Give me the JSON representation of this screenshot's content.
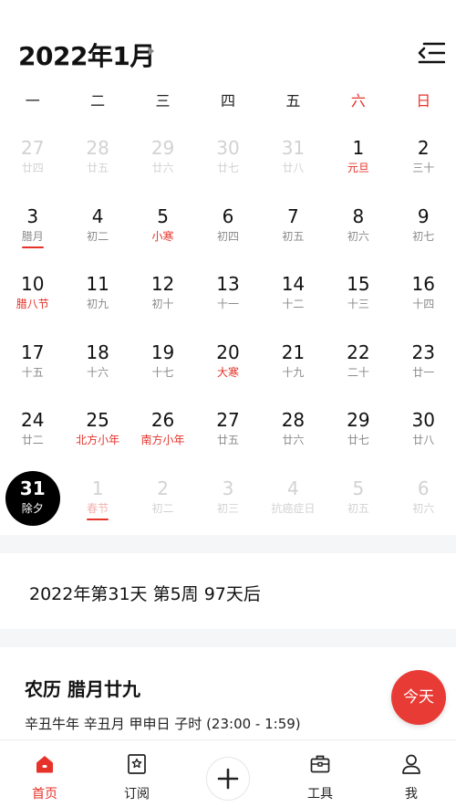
{
  "header": {
    "month_title": "2022年1月"
  },
  "weekdays": [
    "一",
    "二",
    "三",
    "四",
    "五",
    "六",
    "日"
  ],
  "calendar": [
    {
      "day": "27",
      "lunar": "廿四",
      "faded": true
    },
    {
      "day": "28",
      "lunar": "廿五",
      "faded": true
    },
    {
      "day": "29",
      "lunar": "廿六",
      "faded": true
    },
    {
      "day": "30",
      "lunar": "廿七",
      "faded": true
    },
    {
      "day": "31",
      "lunar": "廿八",
      "faded": true
    },
    {
      "day": "1",
      "lunar": "元旦",
      "lunar_red": true
    },
    {
      "day": "2",
      "lunar": "三十"
    },
    {
      "day": "3",
      "lunar": "腊月",
      "underline": true
    },
    {
      "day": "4",
      "lunar": "初二"
    },
    {
      "day": "5",
      "lunar": "小寒",
      "lunar_red": true
    },
    {
      "day": "6",
      "lunar": "初四"
    },
    {
      "day": "7",
      "lunar": "初五"
    },
    {
      "day": "8",
      "lunar": "初六"
    },
    {
      "day": "9",
      "lunar": "初七"
    },
    {
      "day": "10",
      "lunar": "腊八节",
      "lunar_red": true
    },
    {
      "day": "11",
      "lunar": "初九"
    },
    {
      "day": "12",
      "lunar": "初十"
    },
    {
      "day": "13",
      "lunar": "十一"
    },
    {
      "day": "14",
      "lunar": "十二"
    },
    {
      "day": "15",
      "lunar": "十三"
    },
    {
      "day": "16",
      "lunar": "十四"
    },
    {
      "day": "17",
      "lunar": "十五"
    },
    {
      "day": "18",
      "lunar": "十六"
    },
    {
      "day": "19",
      "lunar": "十七"
    },
    {
      "day": "20",
      "lunar": "大寒",
      "lunar_red": true
    },
    {
      "day": "21",
      "lunar": "十九"
    },
    {
      "day": "22",
      "lunar": "二十"
    },
    {
      "day": "23",
      "lunar": "廿一"
    },
    {
      "day": "24",
      "lunar": "廿二"
    },
    {
      "day": "25",
      "lunar": "北方小年",
      "lunar_red": true
    },
    {
      "day": "26",
      "lunar": "南方小年",
      "lunar_red": true
    },
    {
      "day": "27",
      "lunar": "廿五"
    },
    {
      "day": "28",
      "lunar": "廿六"
    },
    {
      "day": "29",
      "lunar": "廿七"
    },
    {
      "day": "30",
      "lunar": "廿八"
    },
    {
      "day": "31",
      "lunar": "除夕",
      "today": true
    },
    {
      "day": "1",
      "lunar": "春节",
      "faded": true,
      "lunar_red": true,
      "underline": true
    },
    {
      "day": "2",
      "lunar": "初二",
      "faded": true
    },
    {
      "day": "3",
      "lunar": "初三",
      "faded": true
    },
    {
      "day": "4",
      "lunar": "抗癌症日",
      "faded": true
    },
    {
      "day": "5",
      "lunar": "初五",
      "faded": true
    },
    {
      "day": "6",
      "lunar": "初六",
      "faded": true
    }
  ],
  "summary": {
    "info": "2022年第31天 第5周 97天后"
  },
  "lunar_detail": {
    "title": "农历 腊月廿九",
    "ganzhi": "辛丑牛年 辛丑月 甲申日 子时 (23:00 - 1:59)"
  },
  "today_button": "今天",
  "nav": {
    "home": "首页",
    "subscribe": "订阅",
    "tools": "工具",
    "me": "我"
  },
  "colors": {
    "accent": "#e5332a",
    "today_circle": "#000000",
    "separator": "#f5f6f8"
  }
}
